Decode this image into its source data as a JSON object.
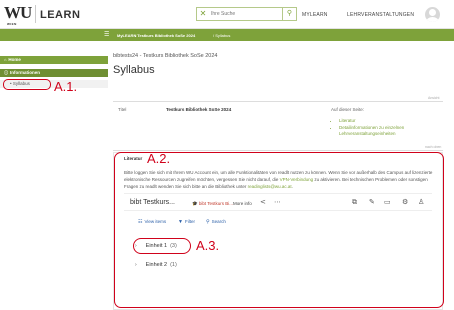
{
  "header": {
    "logo_primary": "WU",
    "logo_sub": "WIEN",
    "logo_app": "LEARN",
    "search_placeholder": "Ihre Suche",
    "nav": [
      "MYLEARN",
      "LEHRVERANSTALTUNGEN"
    ]
  },
  "breadcrumb": {
    "items": [
      "MyLEARN",
      "/ Testkurs Bibliothek SoSe 2024",
      "/ Syllabus"
    ]
  },
  "sidebar": {
    "items": [
      {
        "label": "Home",
        "icon": "home-icon"
      },
      {
        "label": "Informationen",
        "icon": "info-icon"
      },
      {
        "label": "Syllabus",
        "icon": "bullet-icon"
      }
    ]
  },
  "annotations": {
    "a1": "A.1.",
    "a2": "A.2.",
    "a3": "A.3."
  },
  "main": {
    "course_code": "bibtests24 - Testkurs Bibliothek SoSe 2024",
    "page_title": "Syllabus",
    "ansicht": "Ansicht",
    "meta_label": "Titel",
    "meta_value": "Testkurs Bibliothek SoSe 2024",
    "on_page_label": "Auf dieser Seite:",
    "on_page_links": [
      "Literatur",
      "Detailinformationen zu einzelnen",
      "Lehrveranstaltungseinheiten"
    ],
    "nach_oben": "nach oben",
    "literatur": {
      "label": "Literatur",
      "text_1": "Bitte loggen Sie sich mit Ihrem WU Account ein, um alle Funktionalitäten von readlt nutzen zu können. Wenn Sie vor außerhalb des Campus auf lizenzierte elektronische Ressourcen zugreifen möchten, vergessen Sie nicht darauf, die ",
      "vpn_link": "VPN-Verbindung",
      "text_2": " zu aktivieren. Bei technischen Problemen oder sonstigen Fragen zu readlt wenden Sie sich bitte an die Bibliothek unter ",
      "email_link": "readinglists@wu.ac.at",
      "text_3": "."
    },
    "reading_list": {
      "title": "bibt Testkurs...",
      "tag": "bibt Testkurs Bi...",
      "more_info": "More info",
      "toolbar": [
        "View items",
        "Filter",
        "Search"
      ],
      "items": [
        {
          "label": "Einheit 1",
          "count": "(3)"
        },
        {
          "label": "Einheit 2",
          "count": "(1)"
        }
      ]
    }
  },
  "colors": {
    "accent": "#7ea23a",
    "annotation": "#d0021b"
  }
}
